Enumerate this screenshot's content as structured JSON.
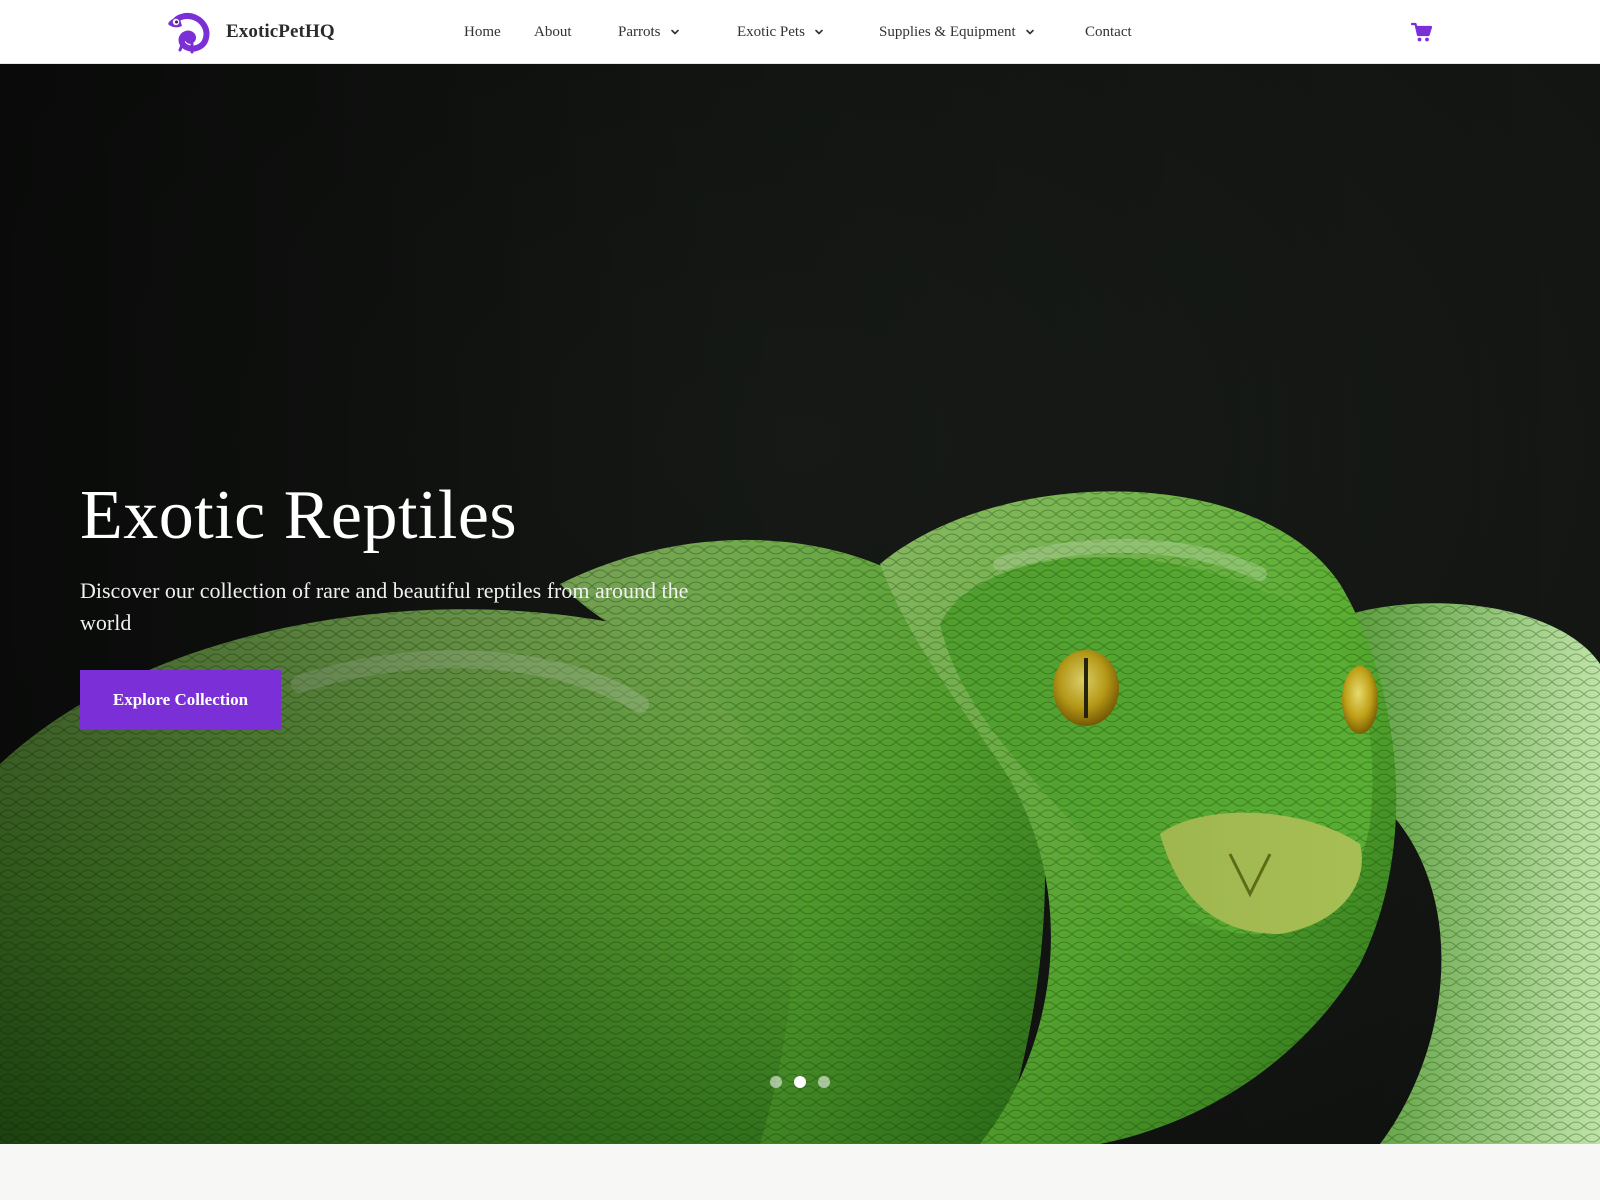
{
  "site": {
    "brand_name": "ExoticPetHQ",
    "accent_color": "#7b2fd6"
  },
  "nav": {
    "items": [
      {
        "label": "Home",
        "has_dropdown": false
      },
      {
        "label": "About",
        "has_dropdown": false
      },
      {
        "label": "Parrots",
        "has_dropdown": true
      },
      {
        "label": "Exotic Pets",
        "has_dropdown": true
      },
      {
        "label": "Supplies & Equipment",
        "has_dropdown": true
      },
      {
        "label": "Contact",
        "has_dropdown": false
      }
    ],
    "cart_icon": "shopping-cart-icon"
  },
  "hero": {
    "title": "Exotic Reptiles",
    "subtitle": "Discover our collection of rare and beautiful reptiles from around the world",
    "button_label": "Explore Collection",
    "image_icon": "green-tree-python-image",
    "slider": {
      "slide_count": 3,
      "active_index": 2
    }
  }
}
